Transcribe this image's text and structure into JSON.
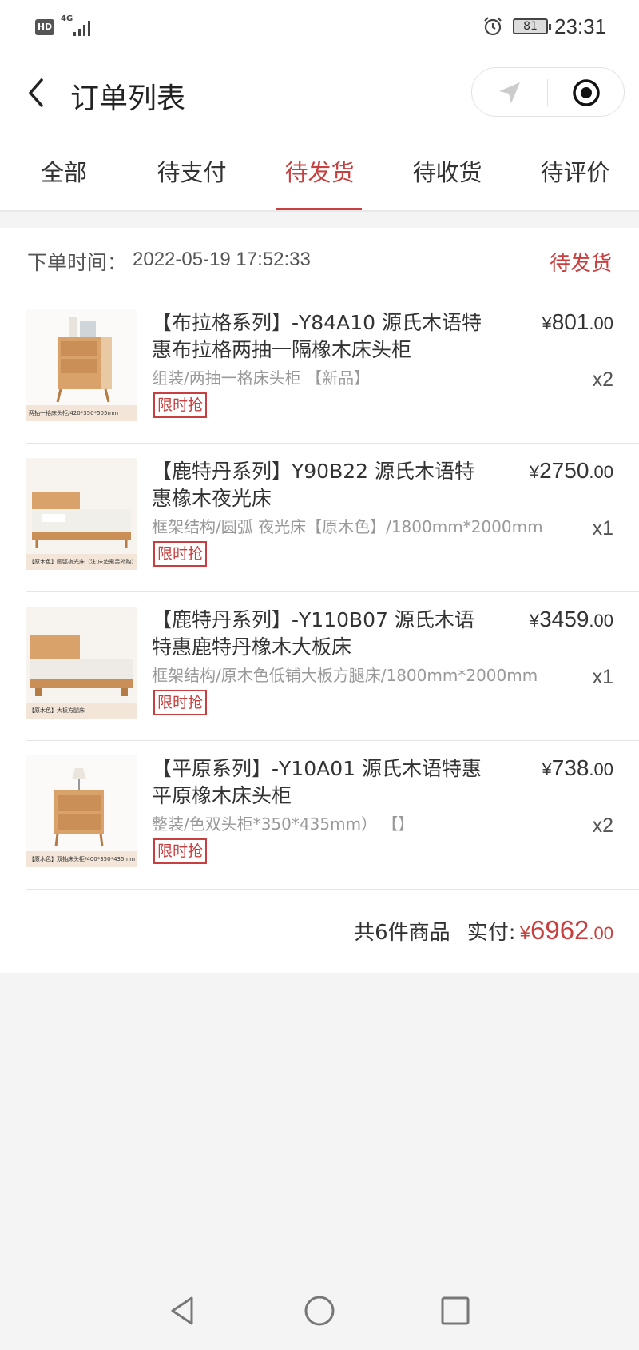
{
  "status_bar": {
    "hd_label": "HD",
    "network": "4G",
    "battery": "81",
    "time": "23:31"
  },
  "nav": {
    "title": "订单列表"
  },
  "tabs": [
    {
      "label": "全部",
      "active": false
    },
    {
      "label": "待支付",
      "active": false
    },
    {
      "label": "待发货",
      "active": true
    },
    {
      "label": "待收货",
      "active": false
    },
    {
      "label": "待评价",
      "active": false
    }
  ],
  "order": {
    "time_label": "下单时间：",
    "time_value": "2022-05-19 17:52:33",
    "status": "待发货",
    "items": [
      {
        "title": "【布拉格系列】-Y84A10 源氏木语特惠布拉格两抽一隔橡木床头柜",
        "spec": "组装/两抽一格床头柜 【新品】",
        "tag": "限时抢",
        "price_symbol": "¥",
        "price_int": "801",
        "price_dec": ".00",
        "qty": "x2",
        "thumb_caption": "两抽一格床头柜/420*350*505mm"
      },
      {
        "title": "【鹿特丹系列】Y90B22 源氏木语特惠橡木夜光床",
        "spec": "框架结构/圆弧 夜光床【原木色】/1800mm*2000mm",
        "tag": "限时抢",
        "price_symbol": "¥",
        "price_int": "2750",
        "price_dec": ".00",
        "qty": "x1",
        "thumb_caption": "【原木色】圆弧夜光床（注:床垫需另外购）"
      },
      {
        "title": "【鹿特丹系列】-Y110B07 源氏木语特惠鹿特丹橡木大板床",
        "spec": "框架结构/原木色低铺大板方腿床/1800mm*2000mm",
        "tag": "限时抢",
        "price_symbol": "¥",
        "price_int": "3459",
        "price_dec": ".00",
        "qty": "x1",
        "thumb_caption": "【原木色】大板方腿床"
      },
      {
        "title": "【平原系列】-Y10A01 源氏木语特惠平原橡木床头柜",
        "spec": "整装/色双头柜*350*435mm） 【】",
        "tag": "限时抢",
        "price_symbol": "¥",
        "price_int": "738",
        "price_dec": ".00",
        "qty": "x2",
        "thumb_caption": "【原木色】双抽床头柜/400*350*435mm"
      }
    ],
    "summary": {
      "count_text": "共6件商品",
      "paid_label": "实付:",
      "price_symbol": "¥",
      "price_int": "6962",
      "price_dec": ".00"
    }
  },
  "colors": {
    "accent": "#c7403f",
    "background": "#f4f4f4",
    "wood": "#d9a26b"
  }
}
